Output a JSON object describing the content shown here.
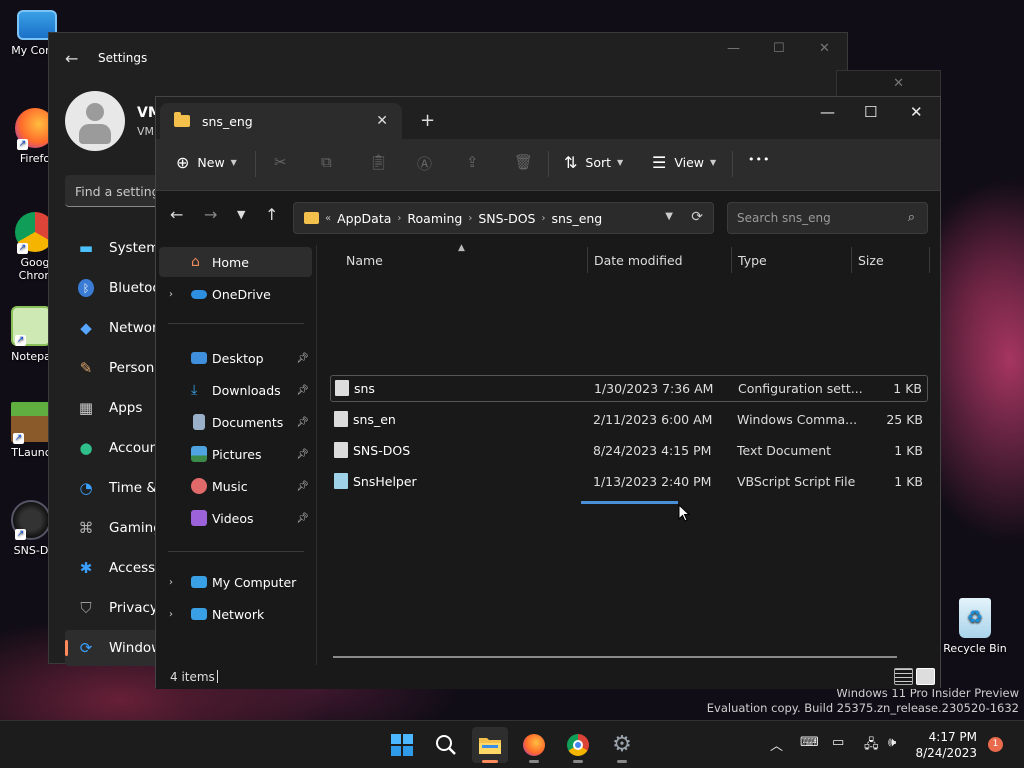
{
  "desktop": {
    "icons": [
      {
        "label": "My Comp",
        "icon": "computer-icon"
      },
      {
        "label": "Firefo",
        "icon": "firefox-icon"
      },
      {
        "label": "Goog\nChron",
        "icon": "chrome-icon"
      },
      {
        "label": "Notepa",
        "icon": "notepad-icon"
      },
      {
        "label": "TLaunc",
        "icon": "minecraft-icon"
      },
      {
        "label": "SNS-D",
        "icon": "sns-dos-icon"
      },
      {
        "label": "Recycle Bin",
        "icon": "recycle-bin-icon"
      }
    ],
    "watermark_line1": "Windows 11 Pro Insider Preview",
    "watermark_line2": "Evaluation copy. Build 25375.zn_release.230520-1632"
  },
  "settings": {
    "title": "Settings",
    "user_name": "VM",
    "user_email": "VM",
    "find_placeholder": "Find a setting",
    "nav": [
      {
        "label": "System",
        "icon": "monitor-icon",
        "color": "#4cc2ff"
      },
      {
        "label": "Bluetoo",
        "icon": "bluetooth-icon",
        "color": "#4c9fff"
      },
      {
        "label": "Networ",
        "icon": "wifi-icon",
        "color": "#58a6ff"
      },
      {
        "label": "Persona",
        "icon": "brush-icon",
        "color": "#d9a36a"
      },
      {
        "label": "Apps",
        "icon": "apps-icon",
        "color": "#c9c9c9"
      },
      {
        "label": "Account",
        "icon": "person-icon",
        "color": "#2fbf8a"
      },
      {
        "label": "Time &",
        "icon": "clock-icon",
        "color": "#3aa0ff"
      },
      {
        "label": "Gaming",
        "icon": "gamepad-icon",
        "color": "#b0b0b0"
      },
      {
        "label": "Accessi",
        "icon": "accessibility-icon",
        "color": "#3aa0ff"
      },
      {
        "label": "Privacy",
        "icon": "shield-icon",
        "color": "#9a9a9a"
      },
      {
        "label": "Window",
        "icon": "update-icon",
        "color": "#3aa0ff"
      }
    ]
  },
  "explorer": {
    "tab_title": "sns_eng",
    "toolbar": {
      "new_label": "New",
      "sort_label": "Sort",
      "view_label": "View",
      "more_label": "•••"
    },
    "address": {
      "overflow": "«",
      "crumbs": [
        "AppData",
        "Roaming",
        "SNS-DOS",
        "sns_eng"
      ],
      "search_placeholder": "Search sns_eng"
    },
    "nav_pane": {
      "home": "Home",
      "onedrive": "OneDrive",
      "quick": [
        {
          "label": "Desktop",
          "color": "#3f8fdc"
        },
        {
          "label": "Downloads",
          "color": "#36a3e6"
        },
        {
          "label": "Documents",
          "color": "#9ab0c8"
        },
        {
          "label": "Pictures",
          "color": "#4fa3e0"
        },
        {
          "label": "Music",
          "color": "#e06a6a"
        },
        {
          "label": "Videos",
          "color": "#9c62d9"
        }
      ],
      "my_computer": "My Computer",
      "network": "Network"
    },
    "columns": {
      "name": "Name",
      "date": "Date modified",
      "type": "Type",
      "size": "Size"
    },
    "files": [
      {
        "name": "sns",
        "date": "1/30/2023 7:36 AM",
        "type": "Configuration sett...",
        "size": "1 KB"
      },
      {
        "name": "sns_en",
        "date": "2/11/2023 6:00 AM",
        "type": "Windows Comma...",
        "size": "25 KB"
      },
      {
        "name": "SNS-DOS",
        "date": "8/24/2023 4:15 PM",
        "type": "Text Document",
        "size": "1 KB"
      },
      {
        "name": "SnsHelper",
        "date": "1/13/2023 2:40 PM",
        "type": "VBScript Script File",
        "size": "1 KB"
      }
    ],
    "status": "4 items"
  },
  "taskbar": {
    "time": "4:17 PM",
    "date": "8/24/2023",
    "notifications": "1",
    "apps": [
      "start-icon",
      "search-icon",
      "file-explorer-icon",
      "firefox-icon",
      "chrome-icon",
      "settings-icon"
    ]
  }
}
